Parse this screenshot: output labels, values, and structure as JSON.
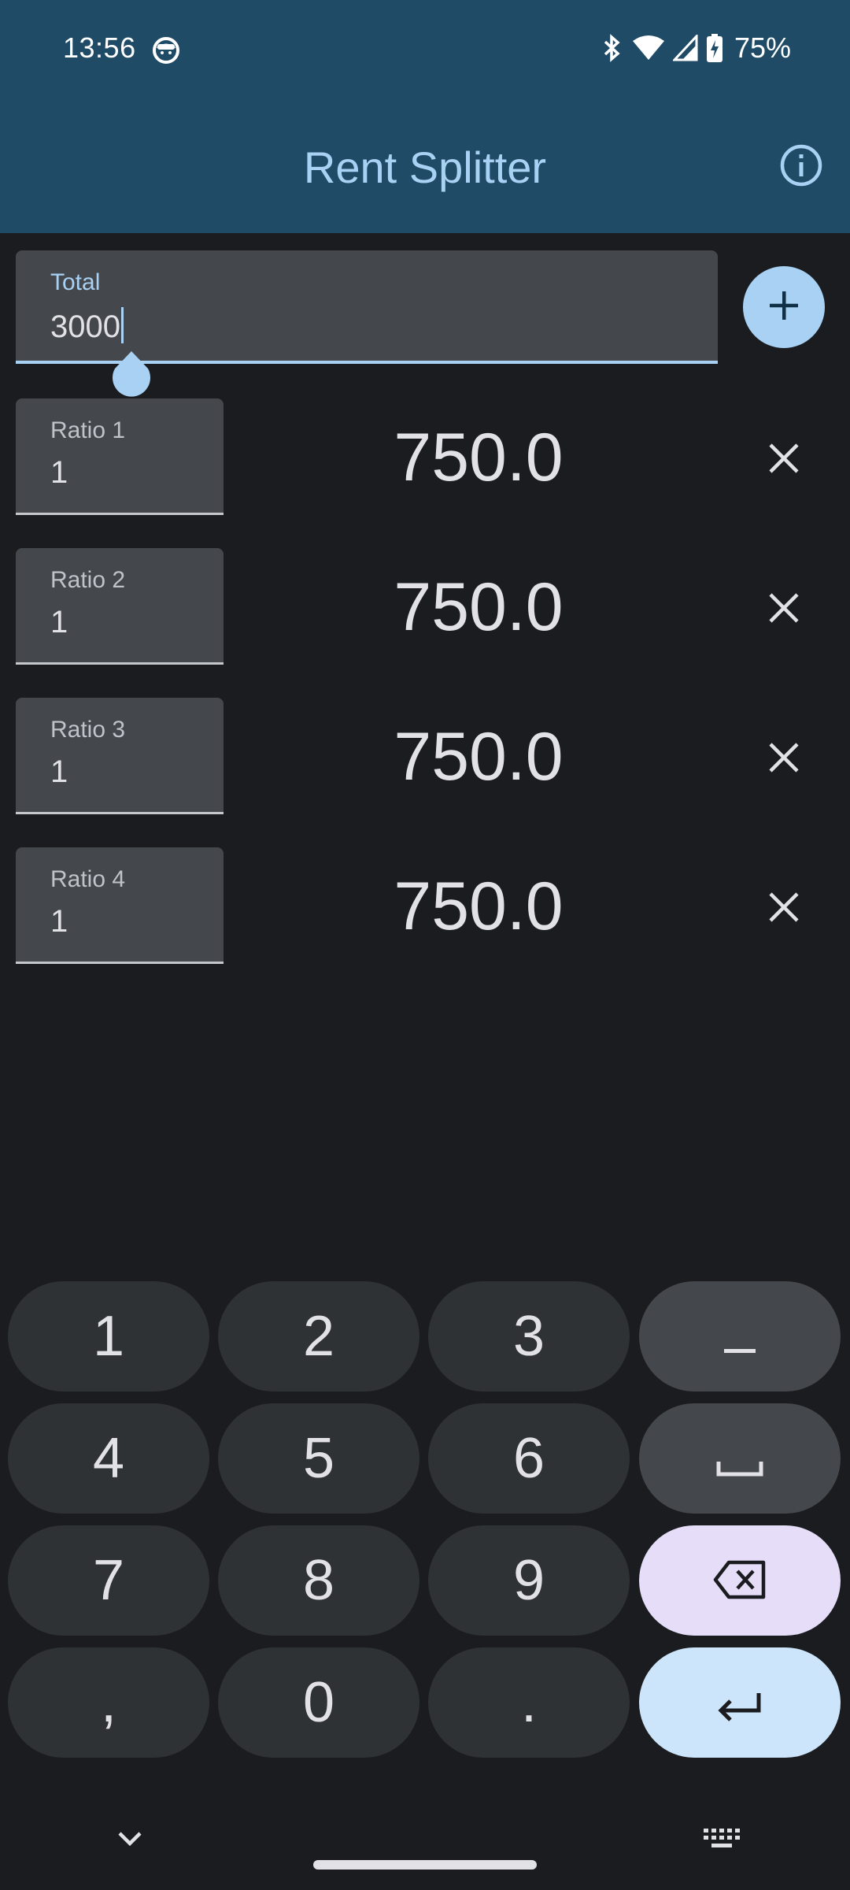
{
  "status_bar": {
    "time": "13:56",
    "battery": "75%",
    "icons": [
      "face-icon",
      "bluetooth-icon",
      "wifi-icon",
      "signal-icon",
      "battery-icon"
    ]
  },
  "app_bar": {
    "title": "Rent Splitter",
    "info_icon": "info-icon"
  },
  "total": {
    "label": "Total",
    "value": "3000"
  },
  "add_button_icon": "plus-icon",
  "ratios": [
    {
      "label": "Ratio 1",
      "value": "1",
      "amount": "750.0"
    },
    {
      "label": "Ratio 2",
      "value": "1",
      "amount": "750.0"
    },
    {
      "label": "Ratio 3",
      "value": "1",
      "amount": "750.0"
    },
    {
      "label": "Ratio 4",
      "value": "1",
      "amount": "750.0"
    }
  ],
  "keyboard": {
    "keys": [
      "1",
      "2",
      "3",
      "−",
      "4",
      "5",
      "6",
      "␣",
      "7",
      "8",
      "9",
      "⌫",
      ",",
      "0",
      ".",
      "↵"
    ]
  },
  "colors": {
    "app_bar": "#1f4b66",
    "accent": "#a9d1f3",
    "background": "#1a1c1f",
    "field": "#44474c",
    "key": "#2f3235",
    "backspace_key": "#e6ddf9",
    "enter_key": "#cde5fa"
  }
}
